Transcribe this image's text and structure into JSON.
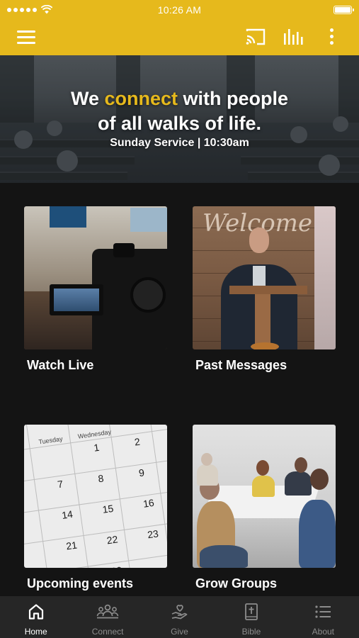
{
  "status": {
    "time": "10:26 AM"
  },
  "colors": {
    "accent": "#e6b91c",
    "background": "#141414",
    "tabbar": "#262626"
  },
  "appbar": {
    "icons": [
      "menu-icon",
      "cast-icon",
      "audio-bars-icon",
      "more-vertical-icon"
    ]
  },
  "hero": {
    "line1_before": "We ",
    "line1_accent": "connect",
    "line1_after": " with people",
    "line2": "of all walks of life.",
    "subtitle": "Sunday Service | 10:30am"
  },
  "tiles": [
    {
      "label": "Watch Live"
    },
    {
      "label": "Past Messages",
      "image_text": "Welcome"
    },
    {
      "label": "Upcoming events"
    },
    {
      "label": "Grow Groups"
    }
  ],
  "calendar_image": {
    "days": [
      "Tuesday",
      "Wednesday"
    ],
    "numbers": [
      "1",
      "2",
      "7",
      "8",
      "9",
      "14",
      "15",
      "16",
      "21",
      "22",
      "23",
      "28",
      "29"
    ]
  },
  "tabbar": {
    "items": [
      {
        "label": "Home",
        "icon": "home-icon",
        "active": true
      },
      {
        "label": "Connect",
        "icon": "people-icon",
        "active": false
      },
      {
        "label": "Give",
        "icon": "give-hand-heart-icon",
        "active": false
      },
      {
        "label": "Bible",
        "icon": "bible-icon",
        "active": false
      },
      {
        "label": "About",
        "icon": "list-icon",
        "active": false
      }
    ]
  }
}
